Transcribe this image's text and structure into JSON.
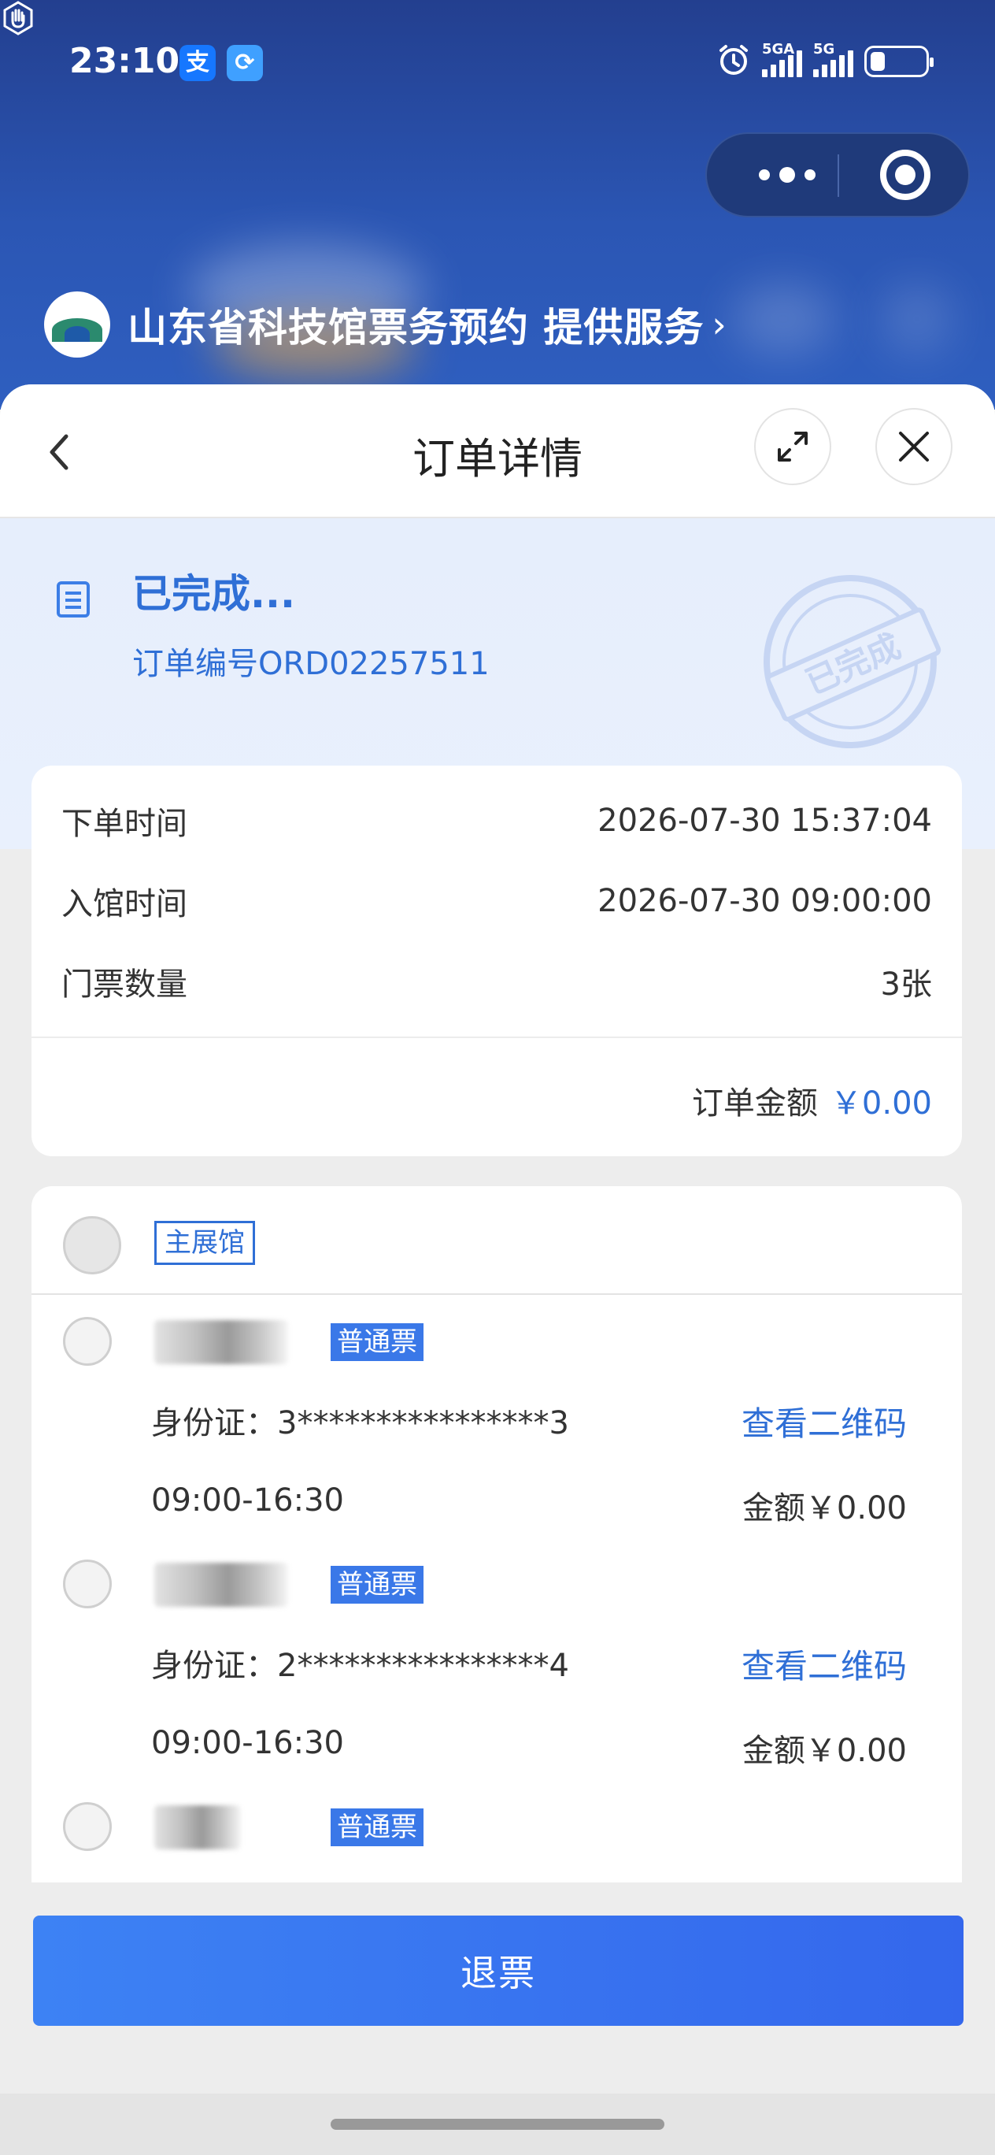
{
  "status_bar": {
    "time": "23:10",
    "network_1": "5GA",
    "network_2": "5G",
    "icons": [
      "alipay-icon",
      "sync-icon",
      "hand-icon",
      "alarm-icon",
      "signal-icon",
      "battery-icon"
    ]
  },
  "miniapp": {
    "provider_name": "山东省科技馆票务预约 提供服务",
    "provider_chevron": "›"
  },
  "nav": {
    "title": "订单详情"
  },
  "order": {
    "status": "已完成...",
    "number": "订单编号ORD02257511",
    "stamp_text": "已完成"
  },
  "info": {
    "rows": [
      {
        "label": "下单时间",
        "value": "2026-07-30 15:37:04"
      },
      {
        "label": "入馆时间",
        "value": "2026-07-30 09:00:00"
      },
      {
        "label": "门票数量",
        "value": "3张"
      }
    ],
    "amount_label": "订单金额",
    "amount_value": "￥0.00"
  },
  "hall": {
    "tag": "主展馆"
  },
  "tickets": [
    {
      "type": "普通票",
      "id": "身份证：3****************3",
      "qr_label": "查看二维码",
      "time": "09:00-16:30",
      "amount": "金额￥0.00"
    },
    {
      "type": "普通票",
      "id": "身份证：2****************4",
      "qr_label": "查看二维码",
      "time": "09:00-16:30",
      "amount": "金额￥0.00"
    },
    {
      "type": "普通票"
    }
  ],
  "actions": {
    "refund": "退票"
  },
  "colors": {
    "accent": "#2f6fd6",
    "button": "#3a74ef",
    "header": "#2b56b4"
  }
}
